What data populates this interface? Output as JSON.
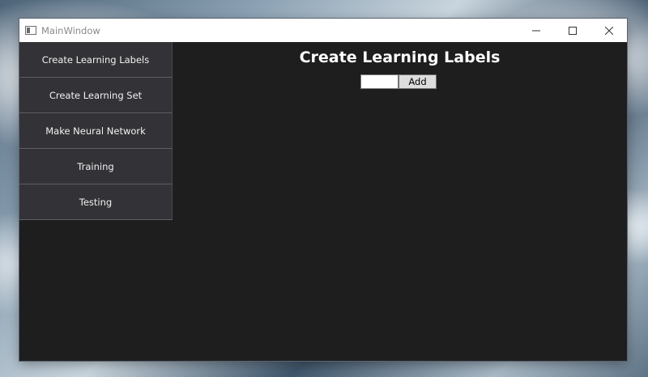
{
  "window": {
    "title": "MainWindow",
    "icon": "window-app-icon",
    "controls": [
      "minimize-icon",
      "maximize-icon",
      "close-icon"
    ]
  },
  "sidebar": {
    "items": [
      {
        "label": "Create Learning Labels"
      },
      {
        "label": "Create Learning Set"
      },
      {
        "label": "Make Neural Network"
      },
      {
        "label": "Training"
      },
      {
        "label": "Testing"
      }
    ]
  },
  "main": {
    "title": "Create Learning Labels",
    "label_input": {
      "value": "",
      "placeholder": ""
    },
    "add_label": "Add"
  },
  "colors": {
    "window_bg": "#1e1e1f",
    "nav_bg": "#333337",
    "titlebar_bg": "#ffffff",
    "text": "#ffffff"
  }
}
